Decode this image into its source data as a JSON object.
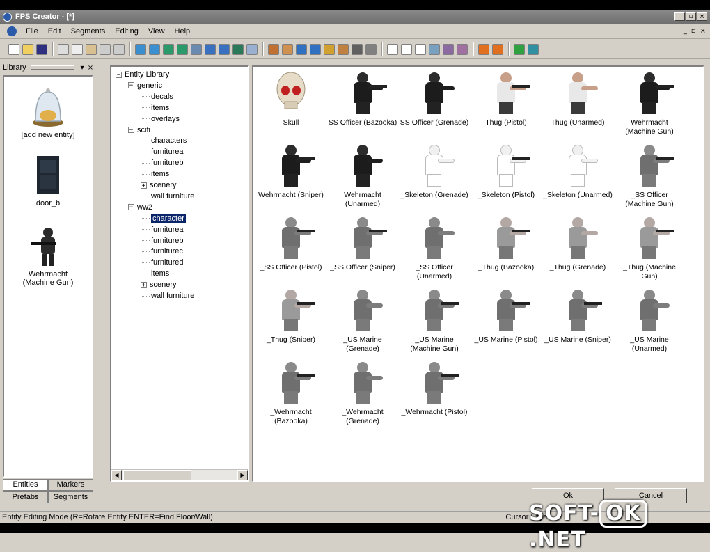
{
  "window": {
    "title": "FPS Creator - [*]"
  },
  "menu": {
    "items": [
      "File",
      "Edit",
      "Segments",
      "Editing",
      "View",
      "Help"
    ]
  },
  "library": {
    "header": "Library",
    "entries": [
      {
        "label": "[add new entity]",
        "icon": "bell-jar-icon"
      },
      {
        "label": "door_b",
        "icon": "door-icon"
      },
      {
        "label": "Wehrmacht\n(Machine Gun)",
        "icon": "soldier-icon"
      }
    ],
    "tabs_top": [
      "Entities",
      "Markers"
    ],
    "tabs_bottom": [
      "Prefabs",
      "Segments"
    ]
  },
  "tree": {
    "nodes": [
      {
        "label": "Entity Library",
        "depth": 0,
        "exp": "-"
      },
      {
        "label": "generic",
        "depth": 1,
        "exp": "-"
      },
      {
        "label": "decals",
        "depth": 2,
        "exp": ""
      },
      {
        "label": "items",
        "depth": 2,
        "exp": ""
      },
      {
        "label": "overlays",
        "depth": 2,
        "exp": ""
      },
      {
        "label": "scifi",
        "depth": 1,
        "exp": "-"
      },
      {
        "label": "characters",
        "depth": 2,
        "exp": ""
      },
      {
        "label": "furniturea",
        "depth": 2,
        "exp": ""
      },
      {
        "label": "furnitureb",
        "depth": 2,
        "exp": ""
      },
      {
        "label": "items",
        "depth": 2,
        "exp": ""
      },
      {
        "label": "scenery",
        "depth": 2,
        "exp": "+"
      },
      {
        "label": "wall furniture",
        "depth": 2,
        "exp": ""
      },
      {
        "label": "ww2",
        "depth": 1,
        "exp": "-"
      },
      {
        "label": "character",
        "depth": 2,
        "exp": "",
        "selected": true
      },
      {
        "label": "furniturea",
        "depth": 2,
        "exp": ""
      },
      {
        "label": "furnitureb",
        "depth": 2,
        "exp": ""
      },
      {
        "label": "furniturec",
        "depth": 2,
        "exp": ""
      },
      {
        "label": "furnitured",
        "depth": 2,
        "exp": ""
      },
      {
        "label": "items",
        "depth": 2,
        "exp": ""
      },
      {
        "label": "scenery",
        "depth": 2,
        "exp": "+"
      },
      {
        "label": "wall furniture",
        "depth": 2,
        "exp": ""
      }
    ]
  },
  "entities": [
    {
      "label": "Skull",
      "kind": "skull"
    },
    {
      "label": "SS Officer (Bazooka)",
      "kind": "dark"
    },
    {
      "label": "SS Officer (Grenade)",
      "kind": "dark"
    },
    {
      "label": "Thug (Pistol)",
      "kind": "thug"
    },
    {
      "label": "Thug (Unarmed)",
      "kind": "thug"
    },
    {
      "label": "Wehrmacht\n(Machine Gun)",
      "kind": "dark"
    },
    {
      "label": "Wehrmacht (Sniper)",
      "kind": "dark"
    },
    {
      "label": "Wehrmacht\n(Unarmed)",
      "kind": "dark"
    },
    {
      "label": "_Skeleton (Grenade)",
      "kind": "skeleton"
    },
    {
      "label": "_Skeleton (Pistol)",
      "kind": "skeleton"
    },
    {
      "label": "_Skeleton (Unarmed)",
      "kind": "skeleton"
    },
    {
      "label": "_SS Officer\n(Machine Gun)",
      "kind": "grey"
    },
    {
      "label": "_SS Officer (Pistol)",
      "kind": "grey"
    },
    {
      "label": "_SS Officer (Sniper)",
      "kind": "grey"
    },
    {
      "label": "_SS Officer\n(Unarmed)",
      "kind": "grey"
    },
    {
      "label": "_Thug (Bazooka)",
      "kind": "greythug"
    },
    {
      "label": "_Thug (Grenade)",
      "kind": "greythug"
    },
    {
      "label": "_Thug (Machine\nGun)",
      "kind": "greythug"
    },
    {
      "label": "_Thug (Sniper)",
      "kind": "greythug"
    },
    {
      "label": "_US Marine\n(Grenade)",
      "kind": "grey"
    },
    {
      "label": "_US Marine\n(Machine Gun)",
      "kind": "grey"
    },
    {
      "label": "_US Marine (Pistol)",
      "kind": "grey"
    },
    {
      "label": "_US Marine (Sniper)",
      "kind": "grey"
    },
    {
      "label": "_US Marine\n(Unarmed)",
      "kind": "grey"
    },
    {
      "label": "_Wehrmacht\n(Bazooka)",
      "kind": "grey"
    },
    {
      "label": "_Wehrmacht\n(Grenade)",
      "kind": "grey"
    },
    {
      "label": "_Wehrmacht (Pistol)",
      "kind": "grey"
    }
  ],
  "buttons": {
    "ok": "Ok",
    "cancel": "Cancel"
  },
  "status": {
    "mode": "Entity Editing Mode (R=Rotate Entity  ENTER=Find Floor/Wall)",
    "layer": "Cursor Layer"
  },
  "watermark": {
    "left": "SOFT-",
    "box": "OK",
    "right": ".NET"
  }
}
